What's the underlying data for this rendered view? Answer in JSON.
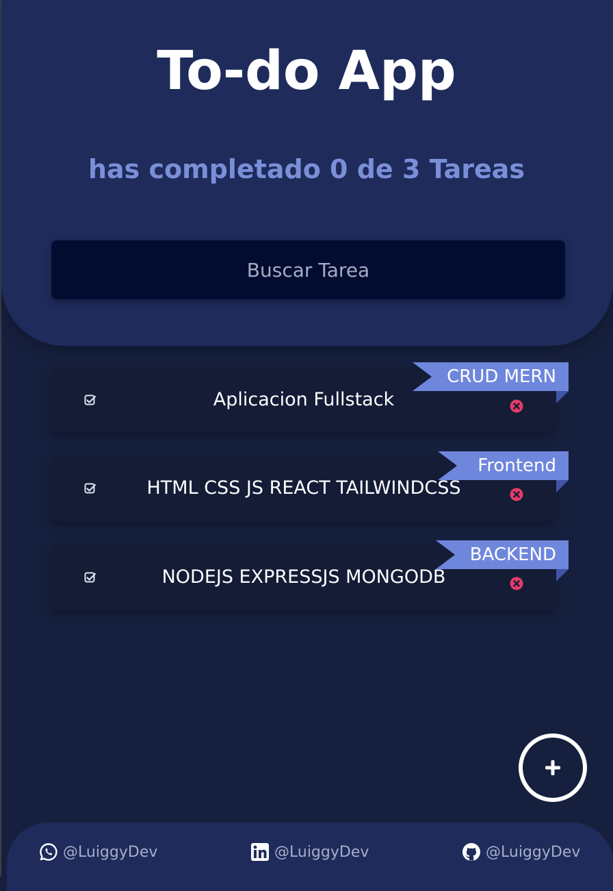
{
  "app": {
    "title": "To-do App",
    "progress_text": "has completado 0 de 3 Tareas"
  },
  "search": {
    "placeholder": "Buscar Tarea"
  },
  "tasks": [
    {
      "text": "Aplicacion Fullstack",
      "tag": "CRUD MERN",
      "completed": false
    },
    {
      "text": "HTML CSS JS REACT TAILWINDCSS",
      "tag": "Frontend",
      "completed": false
    },
    {
      "text": "NODEJS EXPRESSJS MONGODB",
      "tag": "BACKEND",
      "completed": false
    }
  ],
  "add_button": {
    "icon": "plus-icon"
  },
  "footer": {
    "links": [
      {
        "icon": "whatsapp-icon",
        "handle": "@LuiggyDev"
      },
      {
        "icon": "linkedin-icon",
        "handle": "@LuiggyDev"
      },
      {
        "icon": "github-icon",
        "handle": "@LuiggyDev"
      }
    ]
  },
  "colors": {
    "background": "#16203e",
    "header": "#1e2b5b",
    "accent": "#7b8fd8",
    "tag": "#6e86dc",
    "delete": "#e23c68",
    "search_bg": "#020b30"
  }
}
